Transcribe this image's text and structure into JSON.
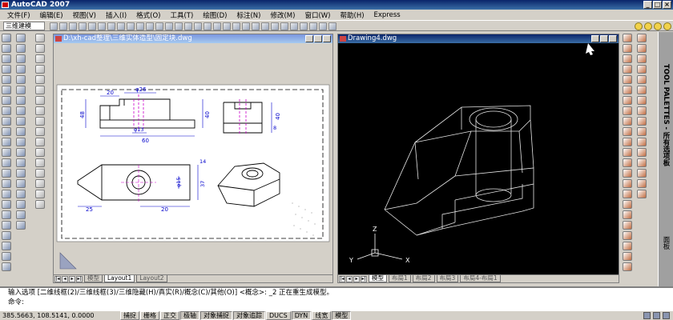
{
  "app": {
    "title": "AutoCAD 2007",
    "icon": "autocad-icon"
  },
  "window_controls": [
    "minimize",
    "maximize",
    "close"
  ],
  "menu": [
    "文件(F)",
    "编辑(E)",
    "视图(V)",
    "插入(I)",
    "格式(O)",
    "工具(T)",
    "绘图(D)",
    "标注(N)",
    "修改(M)",
    "窗口(W)",
    "帮助(H)",
    "Express"
  ],
  "workspace": {
    "selected": "三维建模"
  },
  "drawing1": {
    "title": "D:\\xh-cad整理\\三维实体造型\\固定块.dwg",
    "tabs": [
      "模型",
      "Layout1",
      "Layout2"
    ],
    "active_tab": "Layout1",
    "dims": {
      "top_20": "20",
      "top_phi26": "φ26",
      "left_48": "48",
      "left_40": "40",
      "right_40": "40",
      "right_8": "8",
      "phi13": "φ13",
      "width_60": "60",
      "h14": "14",
      "h37": "37",
      "phi15": "φ15",
      "b25": "25",
      "b20": "20"
    }
  },
  "drawing2": {
    "title": "Drawing4.dwg",
    "tabs": [
      "模型",
      "布局1",
      "布局2",
      "布局3",
      "布局4-布局1"
    ],
    "active_tab": "模型",
    "ucs": {
      "x": "X",
      "y": "Y",
      "z": "Z"
    }
  },
  "tool_palette": {
    "label": "TOOL PALETTES - 所有选项板",
    "label2": "面板"
  },
  "command": {
    "line1": "输入选项 [二维线框(2)/三维线框(3)/三维隐藏(H)/真实(R)/概念(C)/其他(O)] <概念>: _2 正在重生成模型。",
    "line2": "命令:"
  },
  "status": {
    "coords": "385.5663, 108.5141, 0.0000",
    "buttons": [
      "捕捉",
      "栅格",
      "正交",
      "极轴",
      "对象捕捉",
      "对象追踪",
      "DUCS",
      "DYN",
      "线宽",
      "模型"
    ],
    "pressed": [
      "极轴",
      "对象捕捉",
      "对象追踪",
      "DYN",
      "模型"
    ]
  },
  "colors": {
    "title_blue": "#0a246a",
    "dim_blue": "#0000cc",
    "center_magenta": "#cc00cc",
    "model_bg": "#000000"
  }
}
